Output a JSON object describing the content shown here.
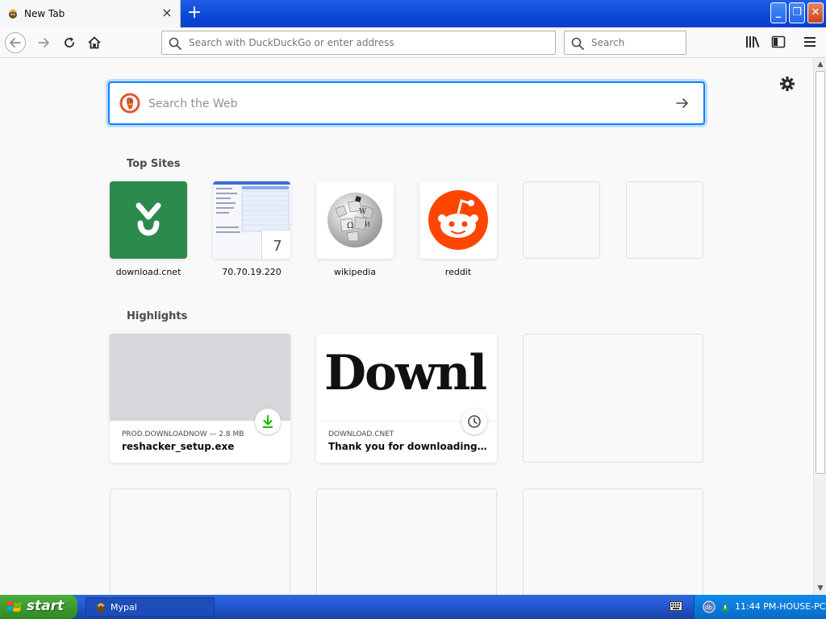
{
  "tab": {
    "title": "New Tab",
    "close_symbol": "×",
    "new_tab_symbol": "+"
  },
  "window_controls": {
    "minimize_symbol": "_",
    "maximize_symbol": "❐",
    "close_symbol": "✕"
  },
  "toolbar": {
    "back_icon": "back-arrow-icon",
    "forward_icon": "forward-arrow-icon",
    "reload_icon": "reload-icon",
    "home_icon": "home-icon",
    "url_placeholder": "Search with DuckDuckGo or enter address",
    "search_placeholder": "Search",
    "library_icon": "library-icon",
    "sidebar_icon": "sidebar-icon",
    "menu_icon": "hamburger-menu-icon"
  },
  "newtab": {
    "search_placeholder": "Search the Web",
    "top_sites_title": "Top Sites",
    "highlights_title": "Highlights",
    "top_sites": [
      {
        "label": "download.cnet",
        "kind": "cnet"
      },
      {
        "label": "70.70.19.220",
        "kind": "screenshot",
        "badge": "7"
      },
      {
        "label": "wikipedia",
        "kind": "wikipedia"
      },
      {
        "label": "reddit",
        "kind": "reddit"
      },
      {
        "label": "",
        "kind": "empty"
      },
      {
        "label": "",
        "kind": "empty"
      }
    ],
    "highlights": [
      {
        "source": "PROD.DOWNLOADNOW — 2.8 MB",
        "title": "reshacker_setup.exe",
        "badge_icon": "download-icon"
      },
      {
        "source": "DOWNLOAD.CNET",
        "title": "Thank you for downloading Reso...",
        "thumb_text": "Downl",
        "badge_icon": "clock-icon"
      }
    ]
  },
  "taskbar": {
    "start_label": "start",
    "task_label": "Mypal",
    "clock": "11:44 PM-HOUSE-PC"
  },
  "colors": {
    "accent": "#0a84ff",
    "cnet_green": "#2b8a4d",
    "reddit_orange": "#ff4500",
    "xp_blue": "#245edb"
  }
}
